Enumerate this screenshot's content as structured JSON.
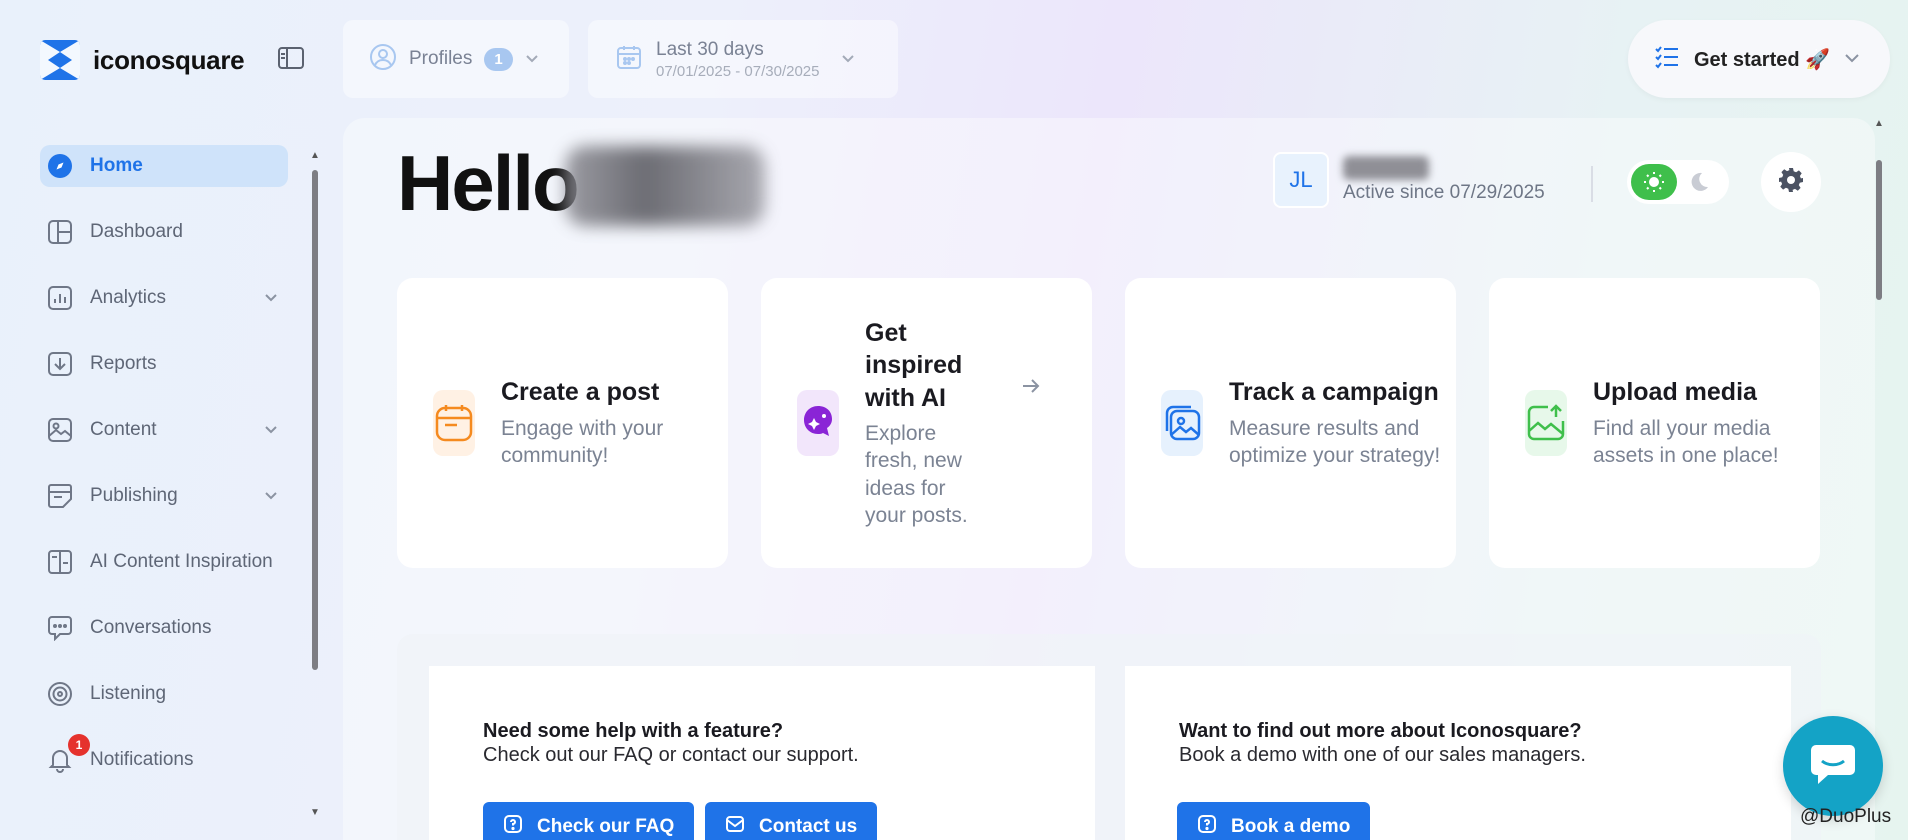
{
  "app": {
    "name": "iconosquare"
  },
  "topbar": {
    "profiles_label": "Profiles",
    "profiles_count": "1",
    "date_range_label": "Last 30 days",
    "date_range_dates": "07/01/2025 - 07/30/2025",
    "get_started_label": "Get started 🚀"
  },
  "sidebar": {
    "items": [
      {
        "label": "Home",
        "icon": "compass-icon",
        "active": true
      },
      {
        "label": "Dashboard",
        "icon": "dashboard-icon"
      },
      {
        "label": "Analytics",
        "icon": "analytics-icon",
        "expandable": true
      },
      {
        "label": "Reports",
        "icon": "reports-icon"
      },
      {
        "label": "Content",
        "icon": "image-icon",
        "expandable": true
      },
      {
        "label": "Publishing",
        "icon": "publishing-icon",
        "expandable": true
      },
      {
        "label": "AI Content Inspiration",
        "icon": "book-icon"
      },
      {
        "label": "Conversations",
        "icon": "chat-icon"
      },
      {
        "label": "Listening",
        "icon": "radar-icon"
      },
      {
        "label": "Notifications",
        "icon": "bell-icon",
        "badge": "1"
      }
    ]
  },
  "main": {
    "greeting": "Hello",
    "user": {
      "initials": "JL",
      "active_since": "Active since 07/29/2025"
    },
    "cards": [
      {
        "title": "Create a post",
        "desc": "Engage with your community!",
        "icon": "calendar-icon",
        "accent": "#f58a1f"
      },
      {
        "title": "Get inspired with AI",
        "desc": "Explore fresh, new ideas for your posts.",
        "icon": "ai-sparkle-icon",
        "accent": "#8a24d6"
      },
      {
        "title": "Track a campaign",
        "desc": "Measure results and optimize your strategy!",
        "icon": "gallery-icon",
        "accent": "#1f73e8"
      },
      {
        "title": "Upload media",
        "desc": "Find all your media assets in one place!",
        "icon": "upload-image-icon",
        "accent": "#3fbf4b"
      }
    ],
    "help": {
      "faq_title": "Need some help with a feature?",
      "faq_sub": "Check out our FAQ or contact our support.",
      "faq_button": "Check our FAQ",
      "contact_button": "Contact us",
      "demo_title": "Want to find out more about Iconosquare?",
      "demo_sub": "Book a demo with one of our sales managers.",
      "demo_button": "Book a demo"
    }
  },
  "watermark": "@DuoPlus",
  "colors": {
    "brand": "#1f73e8",
    "active_bg": "#cfe3fa",
    "toggle_green": "#3fbf4b",
    "chat": "#14a3c6",
    "badge_red": "#e5322d"
  }
}
